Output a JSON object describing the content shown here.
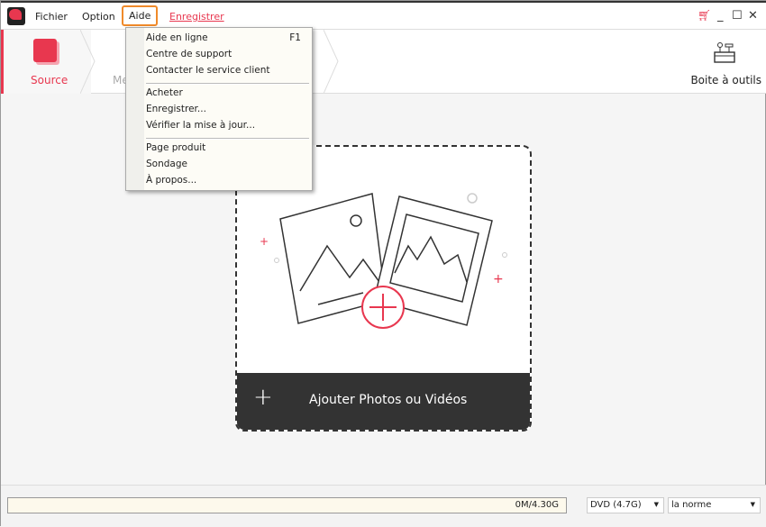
{
  "titlebar": {
    "menus": [
      "Fichier",
      "Option",
      "Aide"
    ],
    "register_link": "Enregistrer",
    "icons": [
      "cart-icon",
      "minimize-icon",
      "maximize-icon",
      "close-icon"
    ],
    "accent": "#e8374f"
  },
  "toolbar": {
    "source": "Source",
    "menu_partial": "Me",
    "tools": "Boite à outils"
  },
  "help_menu": {
    "items": [
      {
        "label": "Aide en ligne",
        "shortcut": "F1"
      },
      {
        "label": "Centre de support"
      },
      {
        "label": "Contacter le service client"
      },
      {
        "label": "Acheter"
      },
      {
        "label": "Enregistrer..."
      },
      {
        "label": "Vérifier la mise à jour..."
      },
      {
        "label": "Page produit"
      },
      {
        "label": "Sondage"
      },
      {
        "label": "À propos..."
      }
    ]
  },
  "dropzone": {
    "add_label": "Ajouter Photos ou Vidéos"
  },
  "bottom": {
    "capacity": "0M/4.30G",
    "disc": "DVD (4.7G)",
    "standard": "la norme"
  }
}
